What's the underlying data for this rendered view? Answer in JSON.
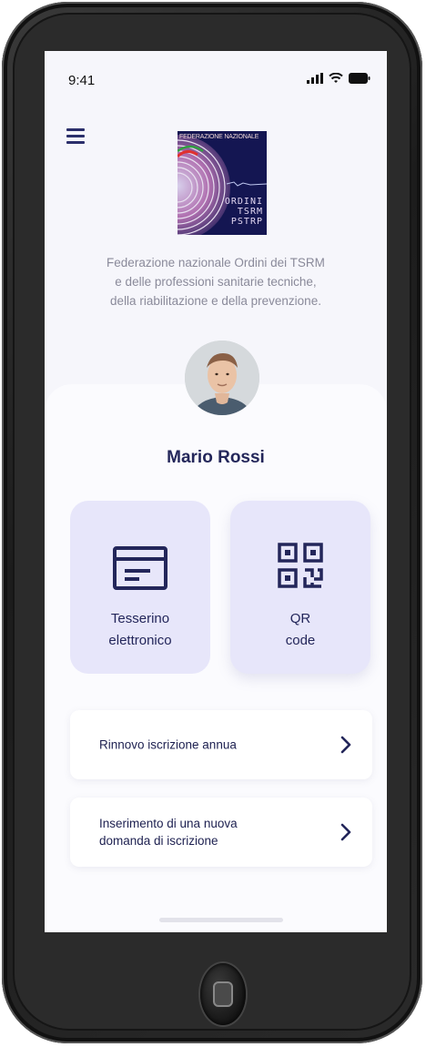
{
  "status_bar": {
    "time": "9:41",
    "icons": [
      "signal-icon",
      "wifi-icon",
      "battery-icon"
    ]
  },
  "header": {
    "menu_icon": "hamburger-menu-icon",
    "logo": {
      "top_text": "FEDERAZIONE NAZIONALE",
      "bottom_lines": [
        "ORDINI",
        "TSRM",
        "PSTRP"
      ]
    },
    "federation_lines": [
      "Federazione nazionale Ordini dei TSRM",
      "e delle professioni sanitarie tecniche,",
      "della riabilitazione e della prevenzione."
    ]
  },
  "profile": {
    "name": "Mario Rossi"
  },
  "tiles": [
    {
      "icon": "card-icon",
      "label_lines": [
        "Tesserino",
        "elettronico"
      ]
    },
    {
      "icon": "qr-code-icon",
      "label_lines": [
        "QR",
        "code"
      ]
    }
  ],
  "menu_items": [
    {
      "label": "Rinnovo iscrizione annua",
      "icon": "chevron-right-icon"
    },
    {
      "label_lines": [
        "Inserimento di una nuova",
        "domanda di iscrizione"
      ],
      "icon": "chevron-right-icon"
    }
  ],
  "colors": {
    "primary_navy": "#23265a",
    "tile_bg": "#e7e6fa",
    "screen_bg": "#f6f6fb",
    "muted_text": "#8a8a9a"
  }
}
